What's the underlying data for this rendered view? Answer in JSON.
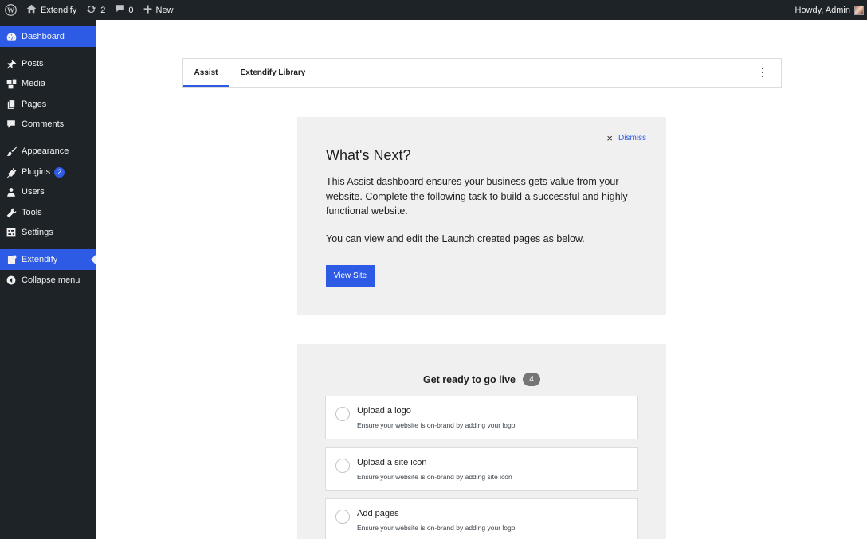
{
  "adminbar": {
    "site_name": "Extendify",
    "updates_count": "2",
    "comments_count": "0",
    "new_label": "New",
    "howdy": "Howdy, Admin"
  },
  "sidebar": {
    "items": [
      {
        "label": "Dashboard",
        "icon": "dashboard-icon"
      },
      {
        "label": "Posts",
        "icon": "pin-icon"
      },
      {
        "label": "Media",
        "icon": "media-icon"
      },
      {
        "label": "Pages",
        "icon": "pages-icon"
      },
      {
        "label": "Comments",
        "icon": "comment-icon"
      },
      {
        "label": "Appearance",
        "icon": "brush-icon"
      },
      {
        "label": "Plugins",
        "icon": "plugin-icon",
        "badge": "2"
      },
      {
        "label": "Users",
        "icon": "user-icon"
      },
      {
        "label": "Tools",
        "icon": "wrench-icon"
      },
      {
        "label": "Settings",
        "icon": "settings-icon"
      },
      {
        "label": "Extendify",
        "icon": "extendify-icon"
      },
      {
        "label": "Collapse menu",
        "icon": "collapse-icon"
      }
    ]
  },
  "tabs": [
    {
      "label": "Assist"
    },
    {
      "label": "Extendify Library"
    }
  ],
  "next_card": {
    "dismiss": "Dismiss",
    "title": "What's Next?",
    "text": "This Assist dashboard ensures your business gets value from your website. Complete the following task to build a successful and highly functional website.",
    "text2": "You can view and edit the Launch created pages as below.",
    "button": "View Site"
  },
  "live_card": {
    "title": "Get ready to go live",
    "count": "4",
    "tasks": [
      {
        "title": "Upload a logo",
        "desc": "Ensure your website is on-brand by adding your logo"
      },
      {
        "title": "Upload a site icon",
        "desc": "Ensure your website is on-brand by adding site icon"
      },
      {
        "title": "Add pages",
        "desc": "Ensure your website is on-brand by adding your logo"
      }
    ]
  },
  "colors": {
    "accent": "#2e5be6",
    "sidebar_bg": "#1d2327",
    "card_bg": "#f0f0f1"
  }
}
